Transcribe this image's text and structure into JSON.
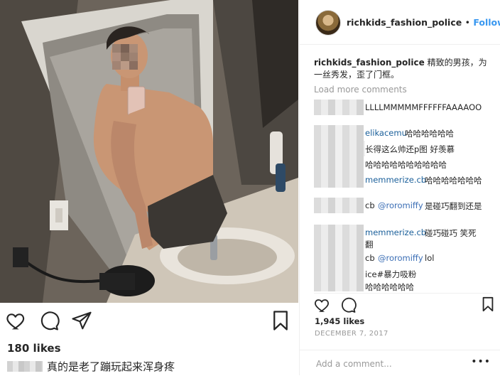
{
  "left": {
    "likes": "180 likes",
    "caption_text": "真的是老了蹦玩起来浑身疼"
  },
  "post": {
    "username": "richkids_fashion_police",
    "separator": "•",
    "follow_label": "Follow",
    "caption_user": "richkids_fashion_police",
    "caption_text": "精致的男孩，为一丝秀发，歪了门框。",
    "load_more": "Load more comments",
    "comments": [
      {
        "user": "",
        "text": "LLLLMMMMMFFFFFFAAAAOO"
      },
      {
        "user": "elikacemu",
        "text": "哈哈哈哈哈哈"
      },
      {
        "user": "",
        "text": "长得这么帅还p图 好羡慕"
      },
      {
        "user": "",
        "text": "哈哈哈哈哈哈哈哈哈哈"
      },
      {
        "user": "memmerize.cb",
        "text": "哈哈哈哈哈哈哈"
      },
      {
        "user": "cb",
        "mention": "@roromiffy",
        "text": "是碰巧翻到还是"
      },
      {
        "user": "memmerize.cb",
        "text": "碰巧碰巧 笑死"
      },
      {
        "user": "",
        "text": "翻"
      },
      {
        "user": "cb",
        "mention": "@roromiffy",
        "text": "lol"
      },
      {
        "user": "",
        "text": "ice#暴力吸粉"
      },
      {
        "user": "",
        "text": "哈哈哈哈哈哈"
      }
    ],
    "likes": "1,945 likes",
    "date": "DECEMBER 7, 2017",
    "add_comment_placeholder": "Add a comment...",
    "more_options": "•••"
  },
  "colors": {
    "link": "#3897f0",
    "text": "#262626",
    "muted": "#999999",
    "border": "#efefef"
  },
  "icons": [
    "heart-icon",
    "comment-icon",
    "share-icon",
    "bookmark-icon"
  ]
}
